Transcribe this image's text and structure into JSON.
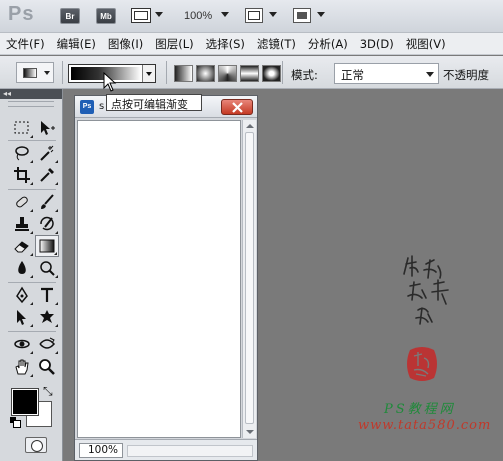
{
  "appbar": {
    "logo": "Ps",
    "bridge_btn": "Br",
    "minibridge_btn": "Mb",
    "zoom_level": "100%"
  },
  "menubar": [
    "文件(F)",
    "编辑(E)",
    "图像(I)",
    "图层(L)",
    "选择(S)",
    "滤镜(T)",
    "分析(A)",
    "3D(D)",
    "视图(V)"
  ],
  "options": {
    "mode_label": "模式:",
    "mode_value": "正常",
    "opacity_label": "不透明度"
  },
  "tooltip": {
    "text": "点按可编辑渐变"
  },
  "document": {
    "icon": "Ps",
    "title": "s",
    "zoom": "100%"
  },
  "watermark": {
    "line1": "PS教程网",
    "line2": "www.tata580.com",
    "signature_text": "他她我你"
  },
  "colors": {
    "workspace": "#7a7a7a",
    "foreground": "#000000",
    "background": "#ffffff",
    "close_button": "#c43a24"
  },
  "tools": [
    "marquee-icon",
    "move-icon",
    "lasso-icon",
    "magic-wand-icon",
    "crop-icon",
    "eyedropper-icon",
    "spot-healing-icon",
    "brush-icon",
    "clone-stamp-icon",
    "history-brush-icon",
    "eraser-icon",
    "gradient-icon",
    "blur-icon",
    "dodge-icon",
    "pen-icon",
    "type-icon",
    "path-selection-icon",
    "custom-shape-icon",
    "3d-rotate-icon",
    "3d-orbit-icon",
    "hand-icon",
    "zoom-icon"
  ]
}
